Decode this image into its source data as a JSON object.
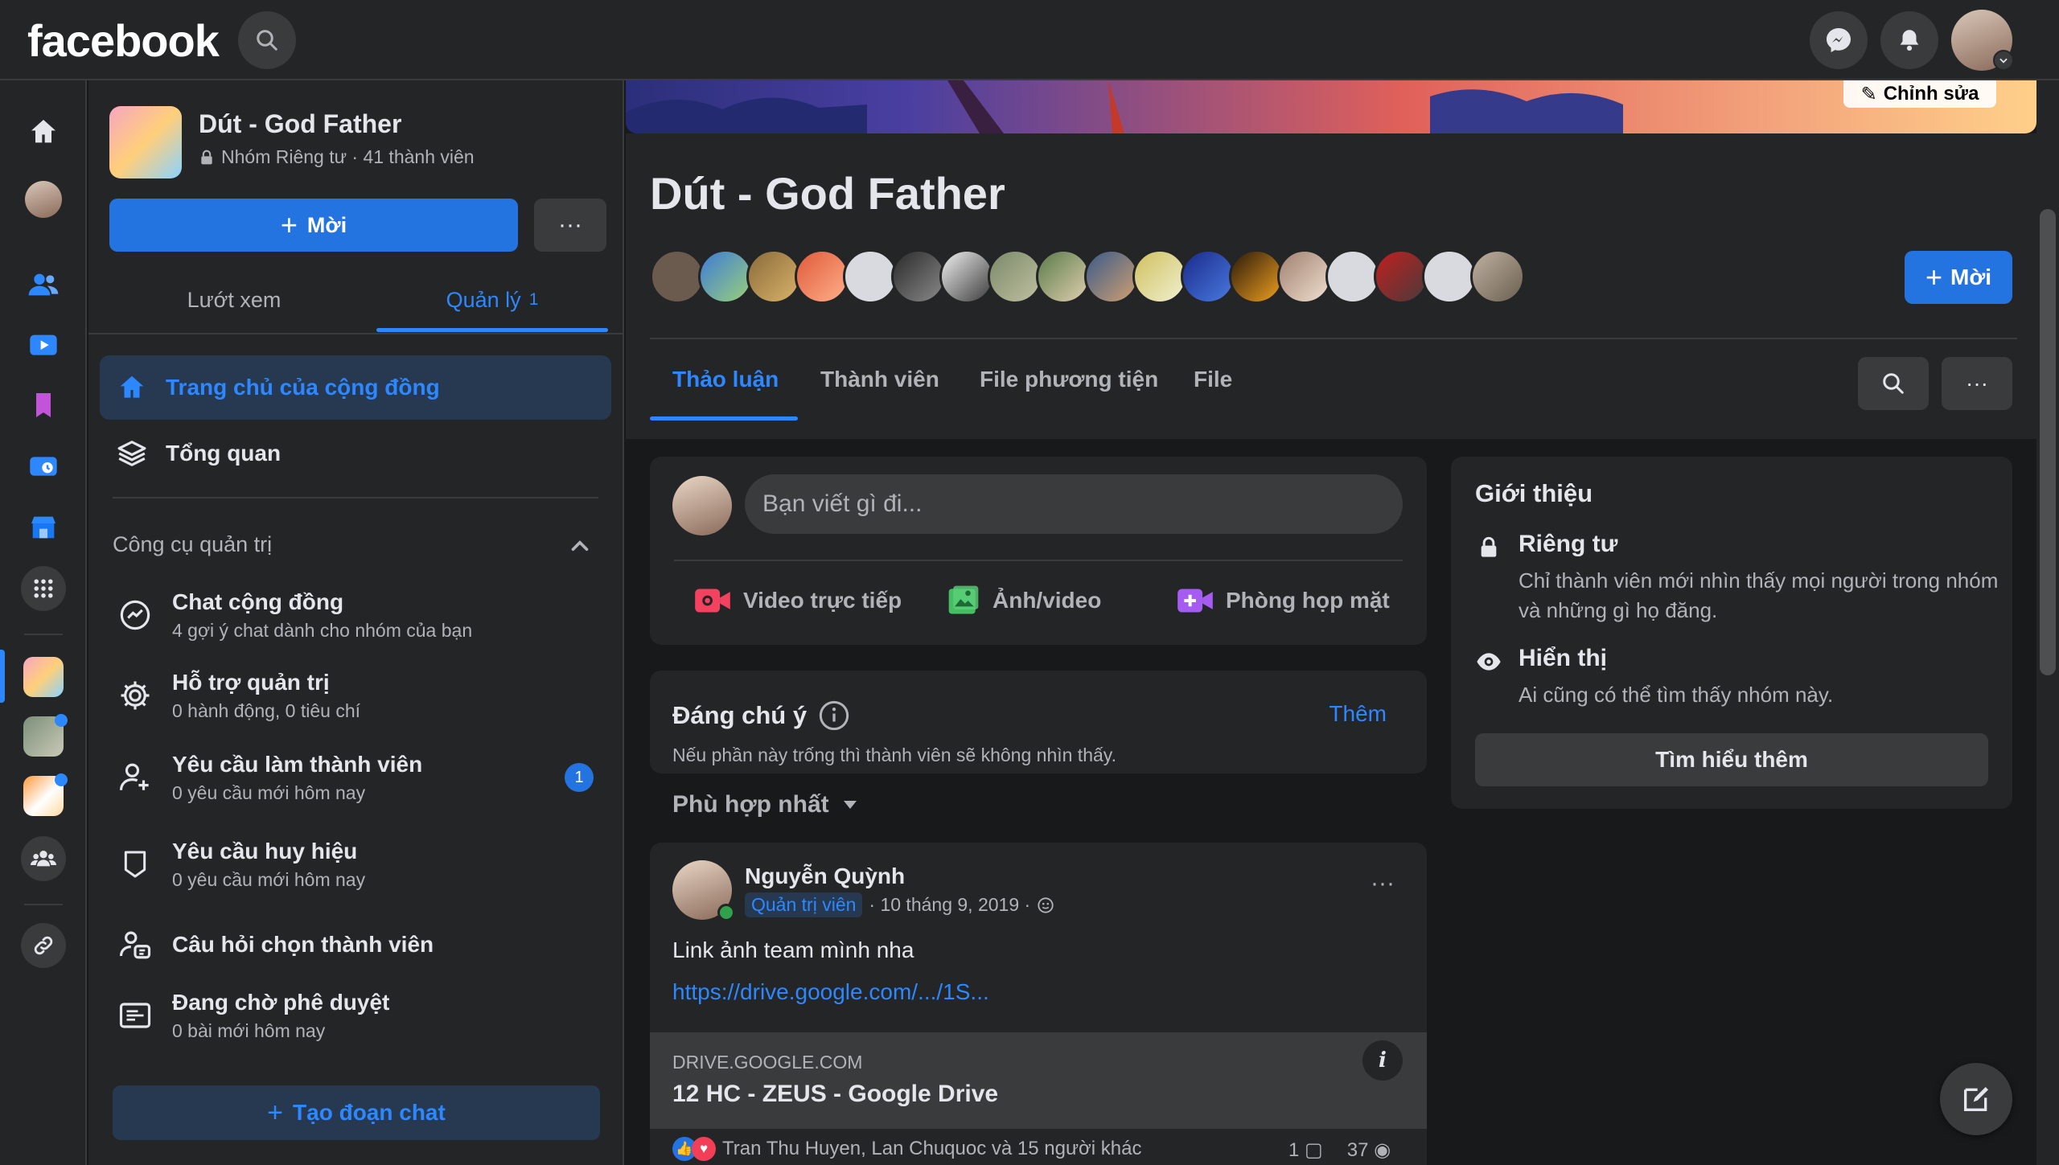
{
  "topbar": {
    "logo": "facebook",
    "icons": [
      "search-icon",
      "messenger-icon",
      "bell-icon",
      "profile-avatar"
    ]
  },
  "left_rail": {
    "icons": [
      "home-icon",
      "profile-avatar",
      "friends-icon",
      "watch-icon",
      "saved-icon",
      "messages-icon",
      "marketplace-icon",
      "apps-grid-icon",
      "group-avatar-active",
      "group-avatar-2",
      "group-avatar-3",
      "groups-icon",
      "link-icon"
    ]
  },
  "sidebar": {
    "group_name": "Dút - God Father",
    "group_meta": "Nhóm Riêng tư · 41 thành viên",
    "invite_label": "Mời",
    "more_label": "···",
    "tabs": [
      {
        "label": "Lướt xem"
      },
      {
        "label": "Quản lý",
        "count": "1"
      }
    ],
    "nav": [
      {
        "label": "Trang chủ của cộng đồng"
      },
      {
        "label": "Tổng quan"
      }
    ],
    "tools_title": "Công cụ quản trị",
    "tools": [
      {
        "title": "Chat cộng đồng",
        "subtitle": "4 gợi ý chat dành cho nhóm của bạn"
      },
      {
        "title": "Hỗ trợ quản trị",
        "subtitle": "0 hành động, 0 tiêu chí"
      },
      {
        "title": "Yêu cầu làm thành viên",
        "subtitle": "0 yêu cầu mới hôm nay",
        "badge": "1"
      },
      {
        "title": "Yêu cầu huy hiệu",
        "subtitle": "0 yêu cầu mới hôm nay"
      },
      {
        "title": "Câu hỏi chọn thành viên",
        "subtitle": ""
      },
      {
        "title": "Đang chờ phê duyệt",
        "subtitle": "0 bài mới hôm nay"
      }
    ],
    "create_chat_label": "Tạo đoạn chat"
  },
  "main": {
    "cover_edit_label": "Chỉnh sửa",
    "group_title": "Dút - God Father",
    "invite_label": "Mời",
    "tabs": [
      {
        "label": "Thảo luận"
      },
      {
        "label": "Thành viên"
      },
      {
        "label": "File phương tiện"
      },
      {
        "label": "File"
      }
    ],
    "more_label": "···",
    "composer": {
      "placeholder": "Bạn viết gì đi...",
      "actions": [
        {
          "label": "Video trực tiếp",
          "color": "#f3425f"
        },
        {
          "label": "Ảnh/video",
          "color": "#45bd62"
        },
        {
          "label": "Phòng họp mặt",
          "color": "#a55cf1"
        }
      ]
    },
    "featured": {
      "title": "Đáng chú ý",
      "more_label": "Thêm",
      "subtitle": "Nếu phần này trống thì thành viên sẽ không nhìn thấy."
    },
    "sort_label": "Phù hợp nhất",
    "post": {
      "author": "Nguyễn Quỳnh",
      "role": "Quản trị viên",
      "date": "· 10 tháng 9, 2019 ·",
      "text": "Link ảnh team mình nha",
      "link": "https://drive.google.com/.../1S...",
      "preview_domain": "DRIVE.GOOGLE.COM",
      "preview_title": "12 HC - ZEUS - Google Drive",
      "reactions_text": "Tran Thu Huyen, Lan Chuquoc và 15 người khác",
      "comments": "1",
      "views": "37"
    },
    "about": {
      "title": "Giới thiệu",
      "items": [
        {
          "title": "Riêng tư",
          "desc": "Chỉ thành viên mới nhìn thấy mọi người trong nhóm và những gì họ đăng."
        },
        {
          "title": "Hiển thị",
          "desc": "Ai cũng có thể tìm thấy nhóm này."
        }
      ],
      "learn_more_label": "Tìm hiểu thêm"
    }
  },
  "colors": {
    "accent": "#2d88ff",
    "button_blue": "#2374e1",
    "bg": "#18191a",
    "surface": "#242526"
  }
}
